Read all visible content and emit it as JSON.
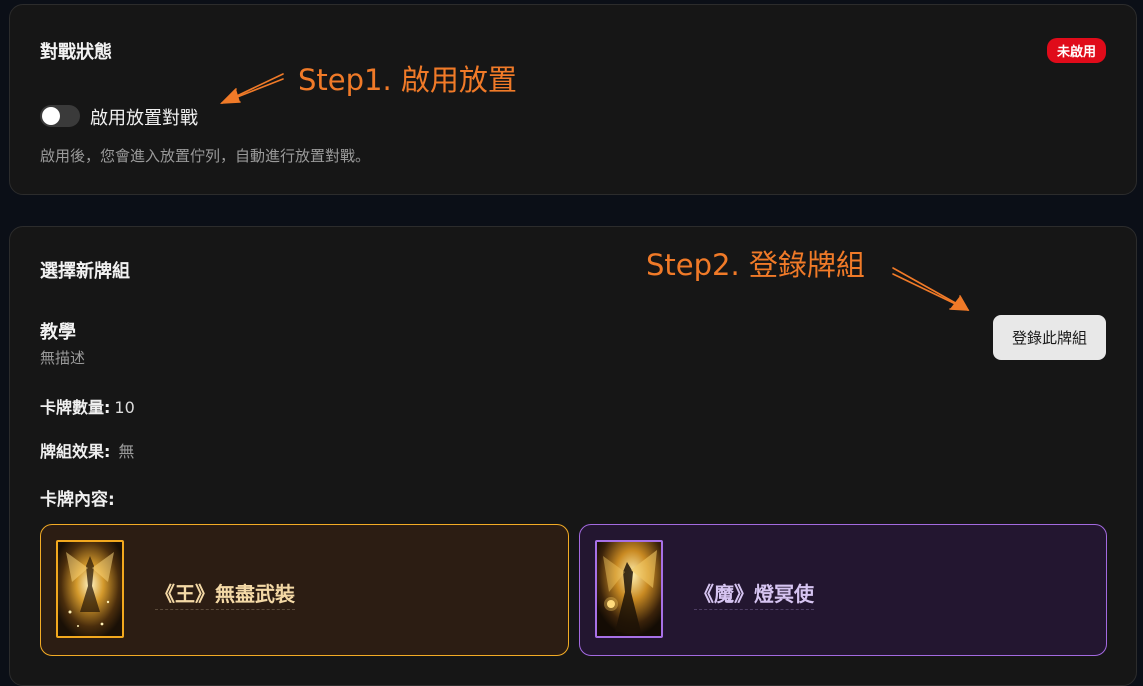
{
  "status": {
    "title": "對戰狀態",
    "badge": "未啟用",
    "toggle_label": "啟用放置對戰",
    "toggle_on": false,
    "hint": "啟用後，您會進入放置佇列，自動進行放置對戰。"
  },
  "annotations": {
    "step1": "Step1. 啟用放置",
    "step2": "Step2. 登錄牌組"
  },
  "deck": {
    "section_title": "選擇新牌組",
    "register_button": "登錄此牌組",
    "name": "教學",
    "description": "無描述",
    "card_count_label": "卡牌數量:",
    "card_count_value": "10",
    "effect_label": "牌組效果:",
    "effect_value": "無",
    "contents_label": "卡牌內容:",
    "cards": [
      {
        "name": "《王》無盡武裝"
      },
      {
        "name": "《魔》燈冥使"
      }
    ]
  },
  "colors": {
    "accent_annotation": "#f07a28",
    "badge_red": "#e00b1a",
    "card_gold_border": "#f3ab25",
    "card_purple_border": "#a36ae0"
  }
}
